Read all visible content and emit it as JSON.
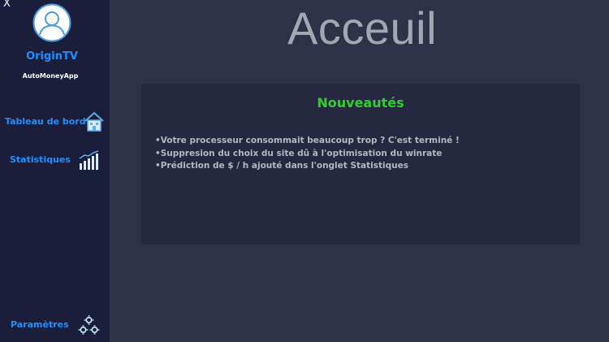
{
  "window": {
    "close_glyph": "X"
  },
  "sidebar": {
    "brand": "OriginTV",
    "app_name": "AutoMoneyApp",
    "items": [
      {
        "label": "Tableau de bord",
        "icon": "house-icon"
      },
      {
        "label": "Statistiques",
        "icon": "bar-chart-icon"
      },
      {
        "label": "Paramètres",
        "icon": "gears-icon"
      }
    ]
  },
  "main": {
    "title": "Acceuil",
    "news": {
      "title": "Nouveautés",
      "items": [
        "Votre processeur consommait beaucoup trop ? C'est terminé !",
        "Suppresion du choix du site dû à l'optimisation du winrate",
        "Prédiction de $ / h ajouté dans l'onglet Statistiques"
      ]
    }
  },
  "colors": {
    "sidebar_bg": "#1b1e3a",
    "main_bg": "#2e3148",
    "panel_bg": "#262840",
    "accent_blue": "#1e90ff",
    "accent_green": "#32cd32"
  }
}
